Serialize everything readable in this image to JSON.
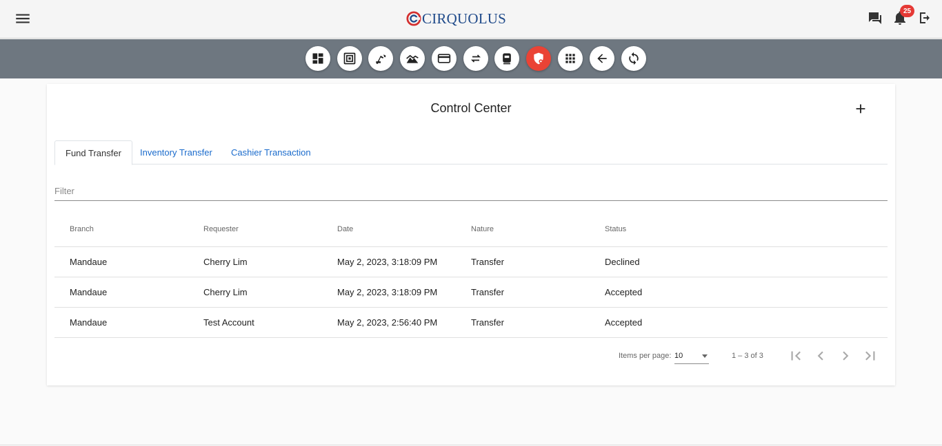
{
  "app": {
    "logo_text": "CIRQUOLUS"
  },
  "header": {
    "notification_count": "25",
    "icons": [
      "menu-icon",
      "chat-icon",
      "bell-icon",
      "logout-icon"
    ]
  },
  "toolbar": {
    "buttons": [
      {
        "icon": "dashboard-icon",
        "active": false
      },
      {
        "icon": "cash-register-icon",
        "active": false
      },
      {
        "icon": "digger-icon",
        "active": false
      },
      {
        "icon": "landscape-chart-icon",
        "active": false
      },
      {
        "icon": "card-icon",
        "active": false
      },
      {
        "icon": "transfer-arrows-icon",
        "active": false
      },
      {
        "icon": "device-icon",
        "active": false
      },
      {
        "icon": "shield-icon",
        "active": true
      },
      {
        "icon": "apps-grid-icon",
        "active": false
      },
      {
        "icon": "back-arrow-icon",
        "active": false
      },
      {
        "icon": "refresh-icon",
        "active": false
      }
    ],
    "active_color": "#ea4335"
  },
  "page": {
    "title": "Control Center",
    "tabs": [
      {
        "label": "Fund Transfer",
        "active": true
      },
      {
        "label": "Inventory Transfer",
        "active": false
      },
      {
        "label": "Cashier Transaction",
        "active": false
      }
    ],
    "filter_placeholder": "Filter"
  },
  "table": {
    "headers": [
      "Branch",
      "Requester",
      "Date",
      "Nature",
      "Status"
    ],
    "rows": [
      [
        "Mandaue",
        "Cherry Lim",
        "May 2, 2023, 3:18:09 PM",
        "Transfer",
        "Declined"
      ],
      [
        "Mandaue",
        "Cherry Lim",
        "May 2, 2023, 3:18:09 PM",
        "Transfer",
        "Accepted"
      ],
      [
        "Mandaue",
        "Test Account",
        "May 2, 2023, 2:56:40 PM",
        "Transfer",
        "Accepted"
      ]
    ]
  },
  "paginator": {
    "items_per_page_label": "Items per page:",
    "items_per_page_value": "10",
    "range_label": "1 – 3 of 3"
  },
  "colors": {
    "toolbar_bg": "#6e7780",
    "link": "#1a6bcc",
    "brand_blue": "#1f4a8a",
    "brand_red": "#d32f2f"
  }
}
